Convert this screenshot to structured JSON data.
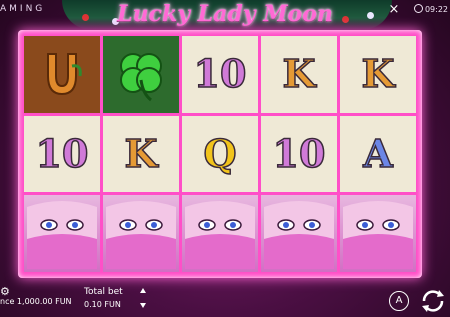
{
  "header": {
    "brand": "AMING",
    "title": "Lucky Lady Moon",
    "close": "×",
    "time": "09:22"
  },
  "reels": [
    [
      {
        "symbol": "horseshoe",
        "label": ""
      },
      {
        "symbol": "clover",
        "label": ""
      },
      {
        "symbol": "10",
        "label": "10"
      },
      {
        "symbol": "K",
        "label": "K"
      },
      {
        "symbol": "K",
        "label": "K"
      }
    ],
    [
      {
        "symbol": "10",
        "label": "10"
      },
      {
        "symbol": "K",
        "label": "K"
      },
      {
        "symbol": "Q",
        "label": "Q"
      },
      {
        "symbol": "10",
        "label": "10"
      },
      {
        "symbol": "A",
        "label": "A"
      }
    ],
    [
      {
        "symbol": "lady",
        "label": ""
      },
      {
        "symbol": "lady",
        "label": ""
      },
      {
        "symbol": "lady",
        "label": ""
      },
      {
        "symbol": "lady",
        "label": ""
      },
      {
        "symbol": "lady",
        "label": ""
      }
    ]
  ],
  "footer": {
    "balance": "nce 1,000.00 FUN",
    "total_bet_label": "Total bet",
    "total_bet_value": "0.10 FUN",
    "autoplay_label": "A"
  },
  "colors": {
    "frame": "#ff4fc8",
    "title": "#ff6ad5",
    "cell_bg": "#efe9d6"
  }
}
